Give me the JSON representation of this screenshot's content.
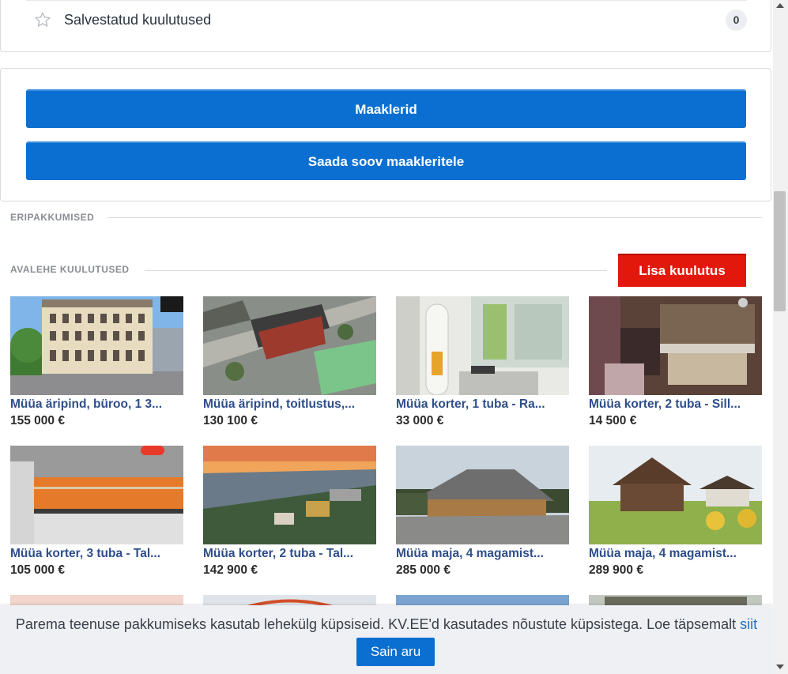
{
  "saved": {
    "label": "Salvestatud kuulutused",
    "count": "0"
  },
  "broker": {
    "btn1": "Maaklerid",
    "btn2": "Saada soov maakleritele"
  },
  "sections": {
    "special": "ERIPAKKUMISED",
    "front": "AVALEHE KUULUTUSED",
    "add_button": "Lisa kuulutus"
  },
  "listings": [
    {
      "title": "Müüa äripind, büroo, 1 3...",
      "price": "155 000 €"
    },
    {
      "title": "Müüa äripind, toitlustus,...",
      "price": "130 100 €"
    },
    {
      "title": "Müüa korter, 1 tuba - Ra...",
      "price": "33 000 €"
    },
    {
      "title": "Müüa korter, 2 tuba - Sill...",
      "price": "14 500 €"
    },
    {
      "title": "Müüa korter, 3 tuba - Tal...",
      "price": "105 000 €"
    },
    {
      "title": "Müüa korter, 2 tuba - Tal...",
      "price": "142 900 €"
    },
    {
      "title": "Müüa maja, 4 magamist...",
      "price": "285 000 €"
    },
    {
      "title": "Müüa maja, 4 magamist...",
      "price": "289 900 €"
    }
  ],
  "cookie": {
    "text": "Parema teenuse pakkumiseks kasutab lehekülg küpsiseid. KV.EE'd kasutades nõustute küpsistega. Loe täpsemalt ",
    "link": "siit",
    "button": "Sain aru"
  }
}
